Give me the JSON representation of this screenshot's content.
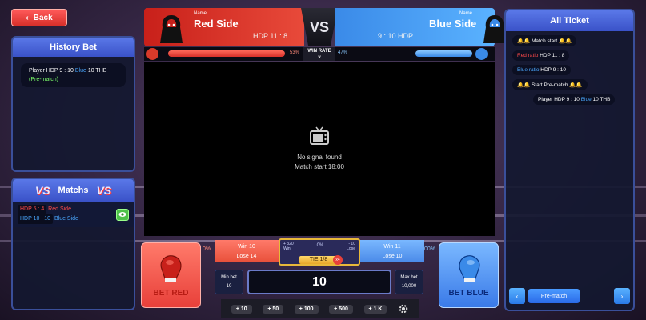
{
  "nav": {
    "back_label": "Back"
  },
  "history": {
    "title": "History Bet",
    "entry": {
      "prefix": "Player HDP 9 : 10",
      "team": "Blue",
      "amount": "10 THB",
      "stage": "(Pre-match)"
    }
  },
  "matches": {
    "title": "Matchs",
    "rows": [
      {
        "hdp": "HDP 5 : 4",
        "side": "Red Side"
      },
      {
        "hdp": "HDP 10 : 10",
        "side": "Blue Side"
      }
    ]
  },
  "fight": {
    "red": {
      "name_label": "Name",
      "name": "Red Side",
      "hdp": "HDP 11 : 8"
    },
    "blue": {
      "name_label": "Name",
      "name": "Blue Side",
      "hdp": "9 : 10 HDP"
    },
    "vs": "VS",
    "winrate": {
      "label": "WIN RATE",
      "sub": "v",
      "red_pct": "53%",
      "blue_pct": "47%",
      "red_value": 0.53,
      "blue_value": 0.47
    }
  },
  "video": {
    "status": "No signal found",
    "start": "Match start 18:00"
  },
  "betting": {
    "bet_red": "BET RED",
    "bet_blue": "BET BLUE",
    "left_pct": "0%",
    "right_pct": "00%",
    "red_win": "Win 10",
    "red_lose": "Lose 14",
    "blue_win": "Win 11",
    "blue_lose": "Lose 10",
    "tie": {
      "left_top": "+ 320",
      "left_bottom": "Win",
      "center": "0%",
      "right_top": "- 10",
      "right_bottom": "Lose",
      "label": "TIE 1/8",
      "mult": "x4"
    },
    "min_label": "Min bet",
    "min_value": "10",
    "max_label": "Max bet",
    "max_value": "10,000",
    "amount": "10",
    "chips": [
      "+ 10",
      "+ 50",
      "+ 100",
      "+ 500",
      "+ 1 K"
    ]
  },
  "ticket": {
    "title": "All Ticket",
    "messages": [
      {
        "text": "🔔🔔 Match start 🔔🔔"
      },
      {
        "label": "Red ratio",
        "text": "HDP 11 : 8"
      },
      {
        "label": "Blue ratio",
        "text": "HDP 9 : 10"
      },
      {
        "text": "🔔🔔 Start Pre-match 🔔🔔"
      }
    ],
    "player_msg": {
      "prefix": "Player HDP 9 : 10",
      "team": "Blue",
      "amount": "10 THB"
    },
    "footer_btn": "Pre-match"
  },
  "colors": {
    "red": "#e8403a",
    "blue": "#3a8ae8",
    "accent_gold": "#e8b83a"
  }
}
